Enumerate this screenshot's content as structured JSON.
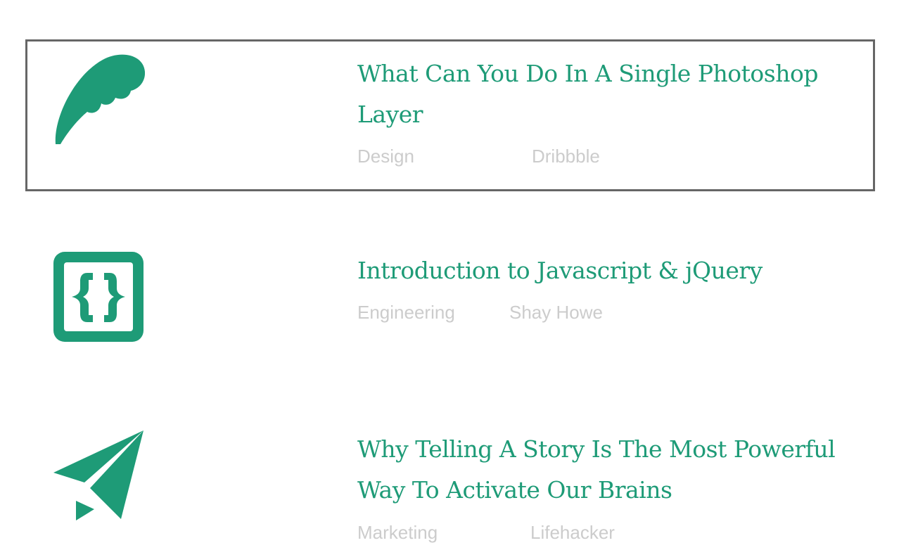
{
  "colors": {
    "accent": "#1e9b77",
    "meta": "#cccccc",
    "focus_border": "#666666"
  },
  "items": [
    {
      "icon": "feather-icon",
      "title": "What Can You Do In A Single Photoshop Layer",
      "category": "Design",
      "source": "Dribbble"
    },
    {
      "icon": "code-braces-icon",
      "title": "Introduction to Javascript & jQuery",
      "category": "Engineering",
      "source": "Shay Howe"
    },
    {
      "icon": "paper-plane-icon",
      "title": "Why Telling A Story Is The Most Powerful Way To Activate Our Brains",
      "category": "Marketing",
      "source": "Lifehacker"
    }
  ]
}
